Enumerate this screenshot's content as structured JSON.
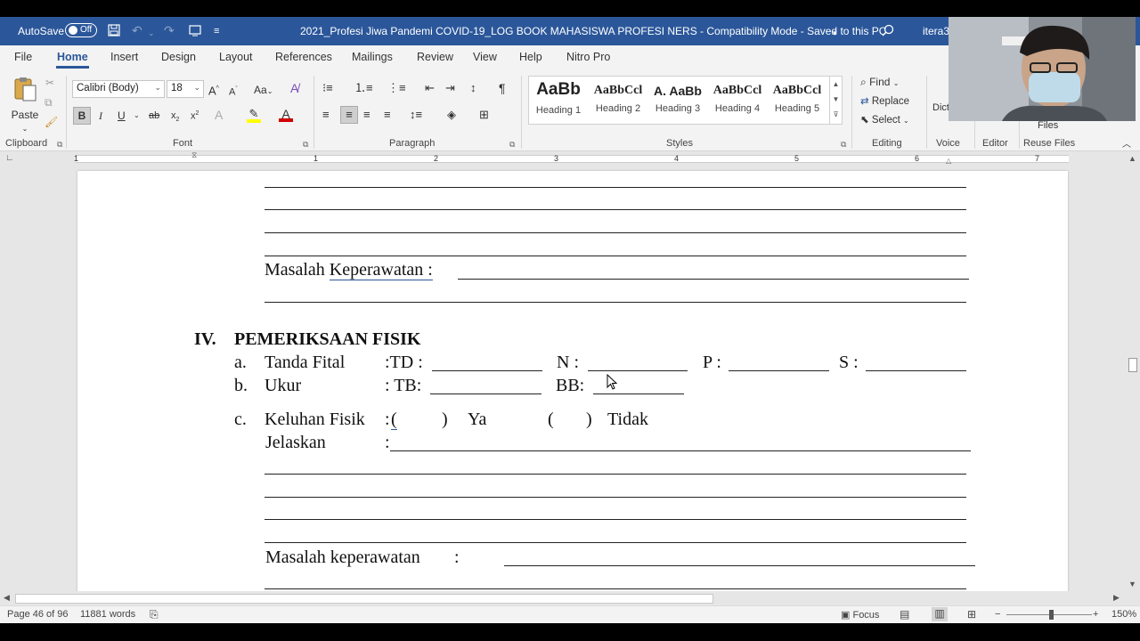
{
  "titlebar": {
    "autosave_label": "AutoSave",
    "autosave_state": "Off",
    "document_title": "2021_Profesi Jiwa Pandemi COVID-19_LOG BOOK MAHASISWA PROFESI NERS  -  Compatibility Mode  -  Saved to this PC",
    "user_name": "itera3"
  },
  "menu_tabs": [
    "File",
    "Home",
    "Insert",
    "Design",
    "Layout",
    "References",
    "Mailings",
    "Review",
    "View",
    "Help",
    "Nitro Pro"
  ],
  "ribbon": {
    "clipboard": {
      "paste_label": "Paste",
      "group_label": "Clipboard"
    },
    "font": {
      "font_name": "Calibri (Body)",
      "font_size": "18",
      "change_case": "Aa",
      "group_label": "Font"
    },
    "paragraph": {
      "group_label": "Paragraph"
    },
    "styles": {
      "group_label": "Styles",
      "items": [
        {
          "sample": "AaBb",
          "name": "Heading 1"
        },
        {
          "sample": "AaBbCcl",
          "name": "Heading 2"
        },
        {
          "sample": "A. AaBb",
          "name": "Heading 3"
        },
        {
          "sample": "AaBbCcl",
          "name": "Heading 4"
        },
        {
          "sample": "AaBbCcl",
          "name": "Heading 5"
        }
      ]
    },
    "editing": {
      "find": "Find",
      "replace": "Replace",
      "select": "Select",
      "group_label": "Editing"
    },
    "voice": {
      "dictate": "Dict",
      "group_label": "Voice"
    },
    "editor": {
      "group_label": "Editor"
    },
    "reuse": {
      "files": "Files",
      "group_label": "Reuse Files"
    }
  },
  "ruler": {
    "numbers": [
      "1",
      "1",
      "2",
      "3",
      "4",
      "5",
      "6",
      "7"
    ]
  },
  "document": {
    "masalah1": "Masalah ",
    "masalah1_link": "Keperawatan :",
    "section_number": "IV.",
    "section_title": "PEMERIKSAAN FISIK",
    "a_label": "a.",
    "a_text": "Tanda Fital",
    "a_td": ":TD :",
    "a_n": "N :",
    "a_p": "P :",
    "a_s": "S :",
    "b_label": "b.",
    "b_text": "Ukur",
    "b_tb": ": TB:",
    "b_bb": "BB:",
    "c_label": "c.",
    "c_text": "Keluhan Fisik",
    "c_colon": ":",
    "c_open1": " (",
    "c_close1": ")",
    "c_ya": "Ya",
    "c_open2": "(",
    "c_close2": ")",
    "c_tidak": "Tidak",
    "jelaskan": "Jelaskan",
    "jelaskan_colon": ":",
    "masalah2": "Masalah keperawatan",
    "masalah2_colon": ":"
  },
  "statusbar": {
    "page": "Page 46 of 96",
    "words": "11881 words",
    "focus": "Focus",
    "zoom": "150%"
  },
  "icons": [
    "save-icon",
    "undo-icon",
    "redo-icon",
    "search-icon",
    "cursor-icon"
  ]
}
